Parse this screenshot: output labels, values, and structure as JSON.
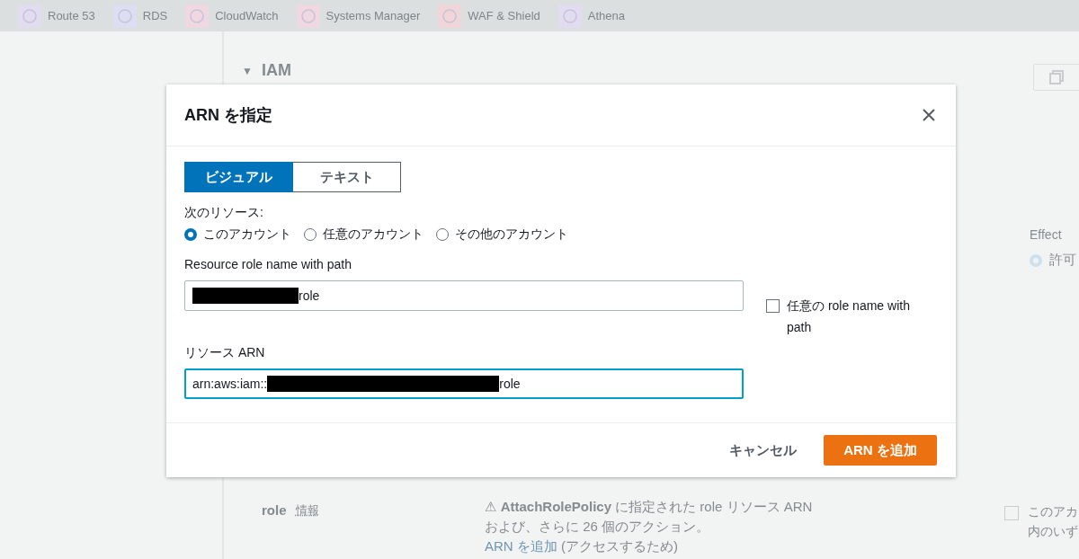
{
  "services_bar": {
    "items": [
      {
        "label": "Route 53",
        "color": "#e2dcf0"
      },
      {
        "label": "RDS",
        "color": "#dcdff2"
      },
      {
        "label": "CloudWatch",
        "color": "#f0d8e0"
      },
      {
        "label": "Systems Manager",
        "color": "#f0d8e0"
      },
      {
        "label": "WAF & Shield",
        "color": "#f0d6d8"
      },
      {
        "label": "Athena",
        "color": "#e2dcf0"
      }
    ]
  },
  "background": {
    "caret": "▼",
    "section_title": "IAM",
    "effect_label": "Effect",
    "effect_option": {
      "label": "許可",
      "selected": true
    },
    "role_row": {
      "label": "role",
      "info_link": "情報",
      "warning_icon": "⚠",
      "warning_lines": [
        "**AttachRolePolicy** に指定された role リソース ARN",
        "および、さらに 26 個のアクション。"
      ],
      "add_link": "ARN を追加",
      "add_note": "(アクセスするため)",
      "checkbox": {
        "lines": [
          "このアカ",
          "内のいず"
        ],
        "checked": false
      }
    }
  },
  "dialog": {
    "title": "ARN を指定",
    "tabs": [
      {
        "label": "ビジュアル",
        "selected": true
      },
      {
        "label": "テキスト",
        "selected": false
      }
    ],
    "resource_label": "次のリソース:",
    "account_options": [
      {
        "label": "このアカウント",
        "selected": true
      },
      {
        "label": "任意のアカウント",
        "selected": false
      },
      {
        "label": "その他のアカウント",
        "selected": false
      }
    ],
    "role_field": {
      "label": "Resource role name with path",
      "redacted": true,
      "value_after": "role",
      "focused": false
    },
    "any_checkbox": {
      "label": "任意の role name with path",
      "checked": false
    },
    "arn_field": {
      "label": "リソース ARN",
      "value_before": "arn:aws:iam::",
      "redacted": true,
      "value_after": "role",
      "focused": true
    },
    "buttons": [
      {
        "label": "キャンセル",
        "kind": "link"
      },
      {
        "label": "ARN を追加",
        "kind": "primary"
      }
    ]
  }
}
